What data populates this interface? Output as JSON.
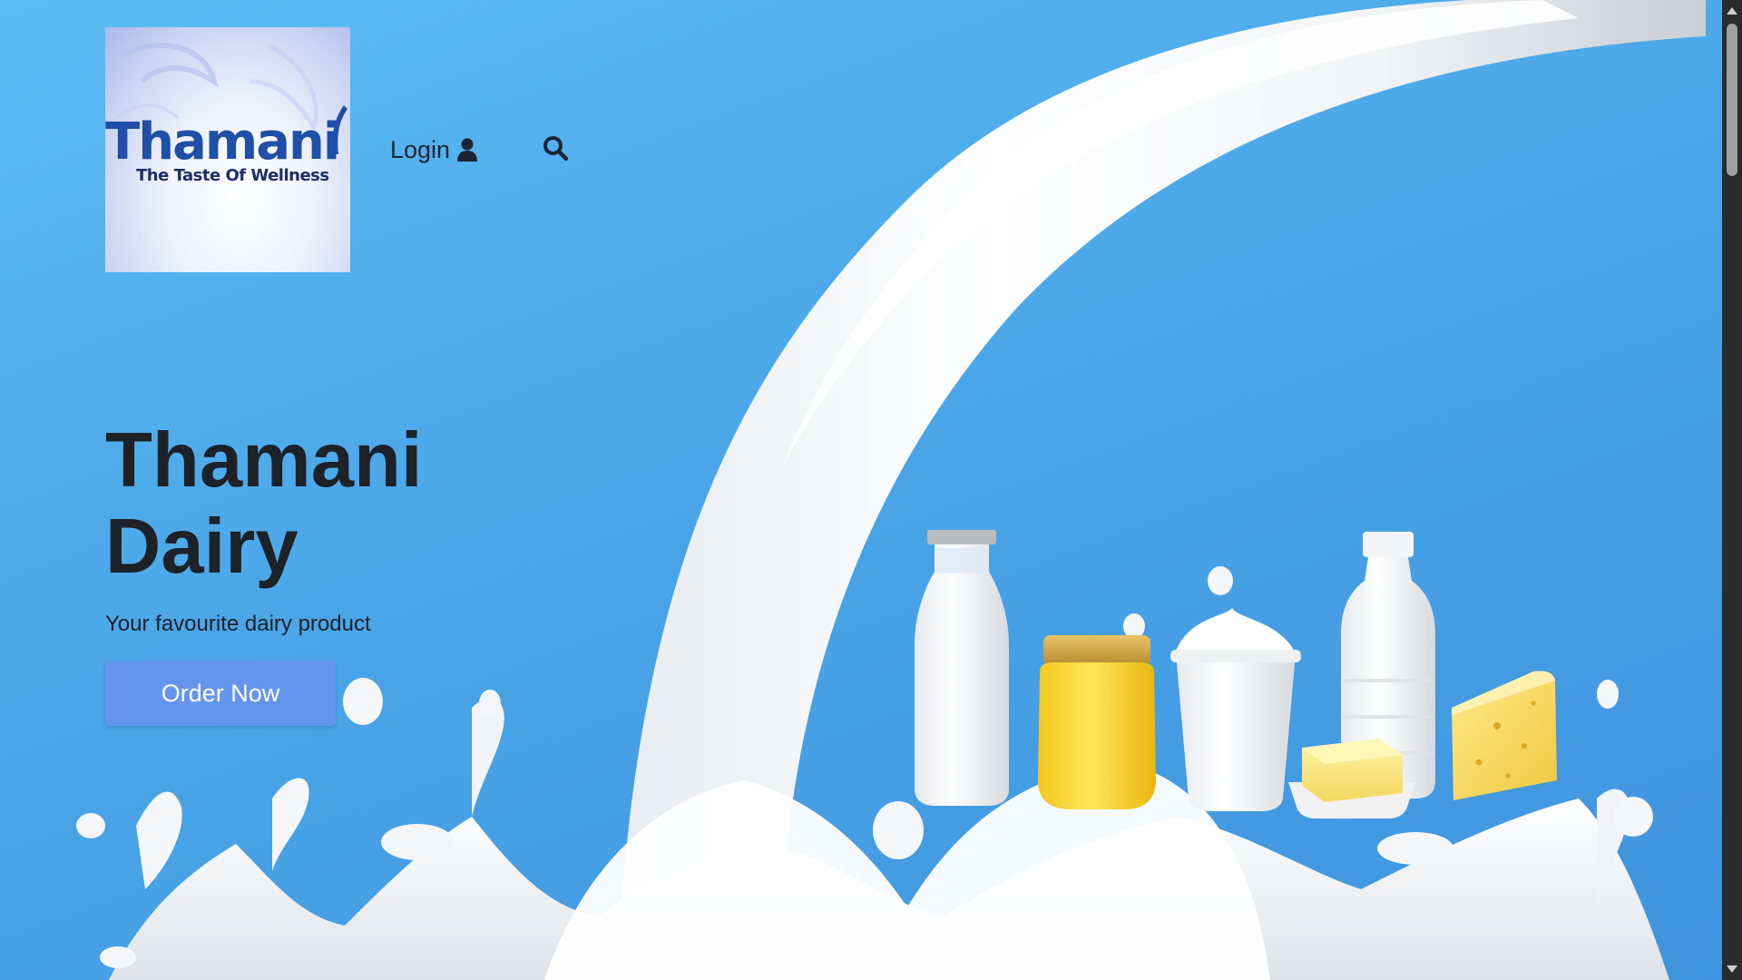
{
  "brand": {
    "name": "Thamani",
    "tagline": "The Taste Of Wellness",
    "primary_color": "#1f4fa6"
  },
  "nav": {
    "login_label": "Login",
    "login_icon": "user-icon",
    "search_icon": "search-icon"
  },
  "hero": {
    "title": "Thamani Dairy",
    "subtitle": "Your favourite dairy product",
    "cta_label": "Order Now",
    "cta_color": "#6495ed",
    "background_color": "#4aa6e8"
  },
  "products_image": {
    "items": [
      "milk-bottle",
      "ghee-jar",
      "yogurt-cup",
      "butter-block",
      "buttermilk-bottle",
      "cheese-wedge"
    ]
  },
  "scrollbar": {
    "up_icon": "arrow-up-icon",
    "down_icon": "arrow-down-icon"
  }
}
